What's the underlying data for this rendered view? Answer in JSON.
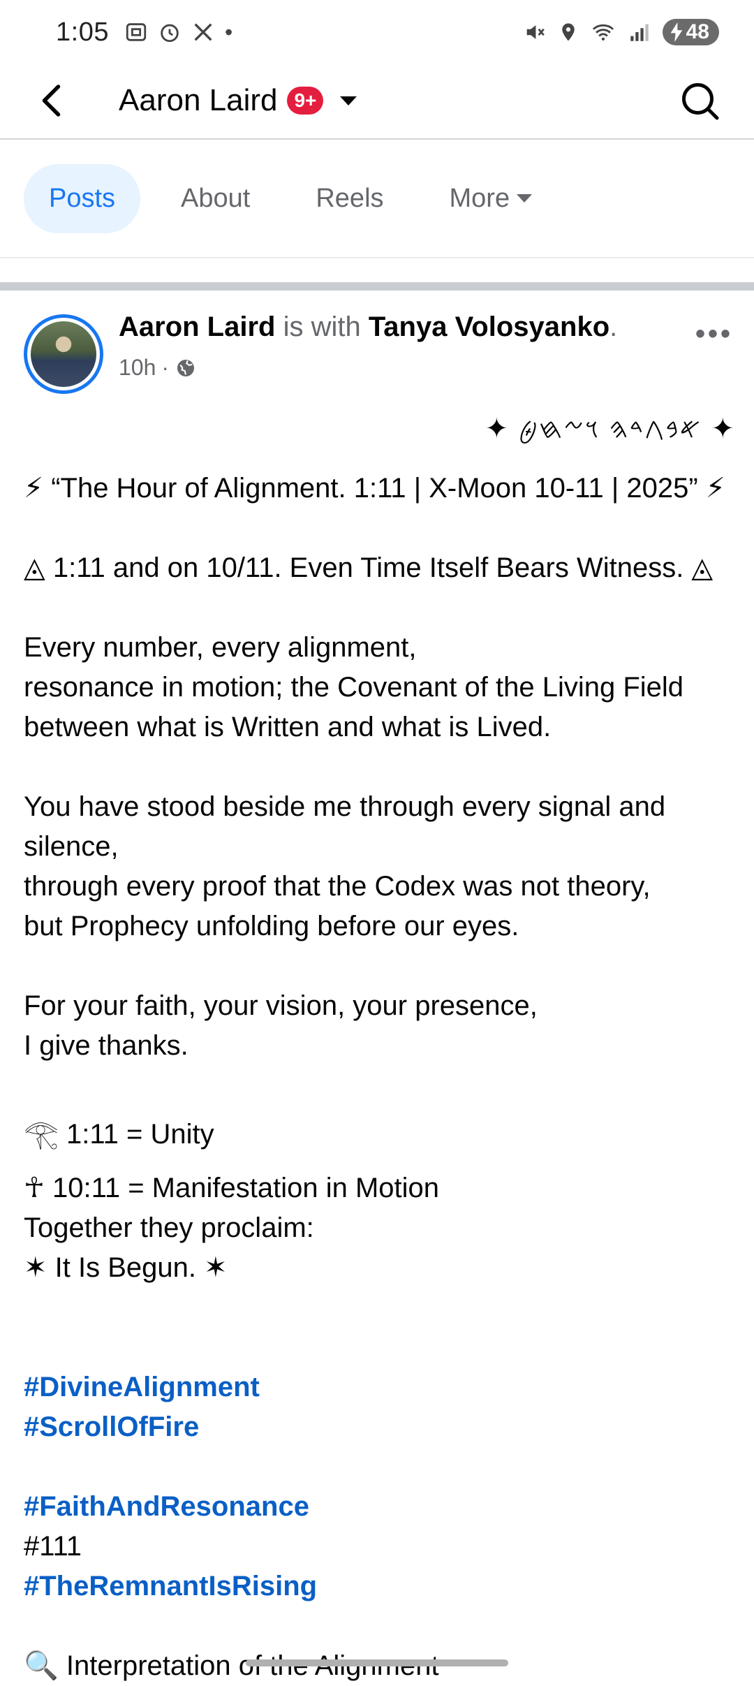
{
  "status_bar": {
    "time": "1:05",
    "left_icons": [
      "screenshot-icon",
      "alarm-icon",
      "x-app-icon",
      "dot"
    ],
    "battery": "48"
  },
  "nav": {
    "title": "Aaron Laird",
    "badge": "9+"
  },
  "tabs": [
    {
      "label": "Posts",
      "active": true
    },
    {
      "label": "About",
      "active": false
    },
    {
      "label": "Reels",
      "active": false
    },
    {
      "label": "More",
      "active": false
    }
  ],
  "post": {
    "author": "Aaron Laird",
    "with_text": " is with ",
    "tagged": "Tanya Volosyanko",
    "tagged_suffix": ".",
    "time": "10h",
    "script_line": "✦ 𐤀𐤁𐤂𐤃𐤄 𐤅𐤆𐤇𐤈 ✦",
    "title_line": "⚡ “The Hour of Alignment. 1:11 | X-Moon 10-11 | 2025” ⚡",
    "witness_line": "◬ 1:11 and on 10/11. Even Time Itself Bears Witness. ◬",
    "para1": "Every number, every alignment,\nresonance in motion; the Covenant of the Living Field\nbetween what is Written and what is Lived.",
    "para2": "You have stood beside me through every signal and silence,\nthrough every proof that the Codex was not theory,\nbut Prophecy unfolding before our eyes.",
    "para3": "For your faith, your vision, your presence,\nI give thanks.",
    "unity_line": "𓂀 1:11 = Unity",
    "manifest_line": "☥ 10:11 = Manifestation in Motion",
    "proclaim_line": "Together they proclaim:",
    "begun_line": "✶ It Is Begun. ✶",
    "hashtags": [
      "#DivineAlignment",
      "#ScrollOfFire",
      "#FaithAndResonance",
      "#111",
      "#TheRemnantIsRising"
    ],
    "interpretation_line": "🔍 Interpretation of the Alignment"
  }
}
